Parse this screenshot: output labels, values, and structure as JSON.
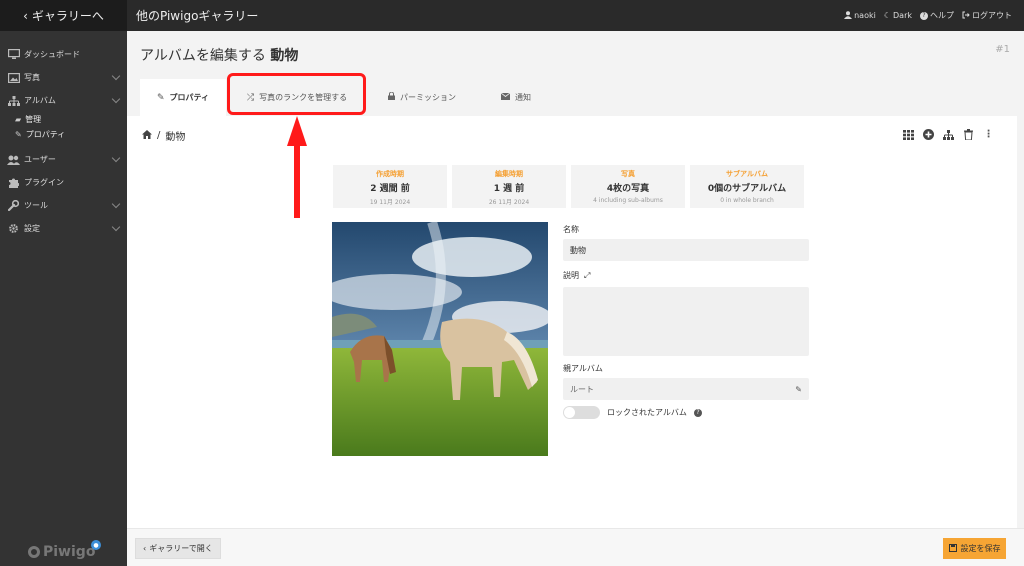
{
  "sidebar": {
    "back_label": "ギャラリーへ",
    "items": [
      {
        "label": "ダッシュボード",
        "icon": "monitor-icon"
      },
      {
        "label": "写真",
        "icon": "image-icon"
      },
      {
        "label": "アルバム",
        "icon": "sitemap-icon"
      },
      {
        "label": "ユーザー",
        "icon": "users-icon"
      },
      {
        "label": "プラグイン",
        "icon": "puzzle-icon"
      },
      {
        "label": "ツール",
        "icon": "wrench-icon"
      },
      {
        "label": "設定",
        "icon": "gear-icon"
      }
    ],
    "album_sub": [
      {
        "label": "管理",
        "icon": "folder-open-icon"
      },
      {
        "label": "プロパティ",
        "icon": "pencil-icon"
      }
    ],
    "logo": "Piwigo"
  },
  "topbar": {
    "gallery_title": "他のPiwigoギャラリー",
    "user": "naoki",
    "theme": "Dark",
    "help": "ヘルプ",
    "logout": "ログアウト"
  },
  "header": {
    "title_prefix": "アルバムを編集する",
    "title_name": "動物",
    "album_id": "#1",
    "tabs": [
      {
        "label": "プロパティ",
        "icon": "pencil-icon",
        "active": true
      },
      {
        "label": "写真のランクを管理する",
        "icon": "shuffle-icon",
        "active": false
      },
      {
        "label": "パーミッション",
        "icon": "lock-icon",
        "active": false
      },
      {
        "label": "通知",
        "icon": "envelope-icon",
        "active": false
      }
    ]
  },
  "breadcrumb": {
    "separator": "/",
    "current": "動物"
  },
  "stats": [
    {
      "label": "作成時期",
      "value": "2 週間 前",
      "detail": "19 11月 2024"
    },
    {
      "label": "編集時期",
      "value": "1 週 前",
      "detail": "26 11月 2024"
    },
    {
      "label": "写真",
      "value": "4枚の写真",
      "detail": "4 including sub-albums"
    },
    {
      "label": "サブアルバム",
      "value": "0個のサブアルバム",
      "detail": "0 in whole branch"
    }
  ],
  "form": {
    "name_label": "名称",
    "name_value": "動物",
    "desc_label": "説明",
    "desc_value": "",
    "parent_label": "親アルバム",
    "parent_value": "ルート",
    "locked_label": "ロックされたアルバム",
    "locked": false
  },
  "footer": {
    "back_label": "ギャラリーで開く",
    "save_label": "設定を保存"
  },
  "colors": {
    "accent": "#f6a534",
    "highlight": "#ff1a1a",
    "sidebar_bg": "#333333",
    "topbar_bg": "#2a2a2a"
  }
}
